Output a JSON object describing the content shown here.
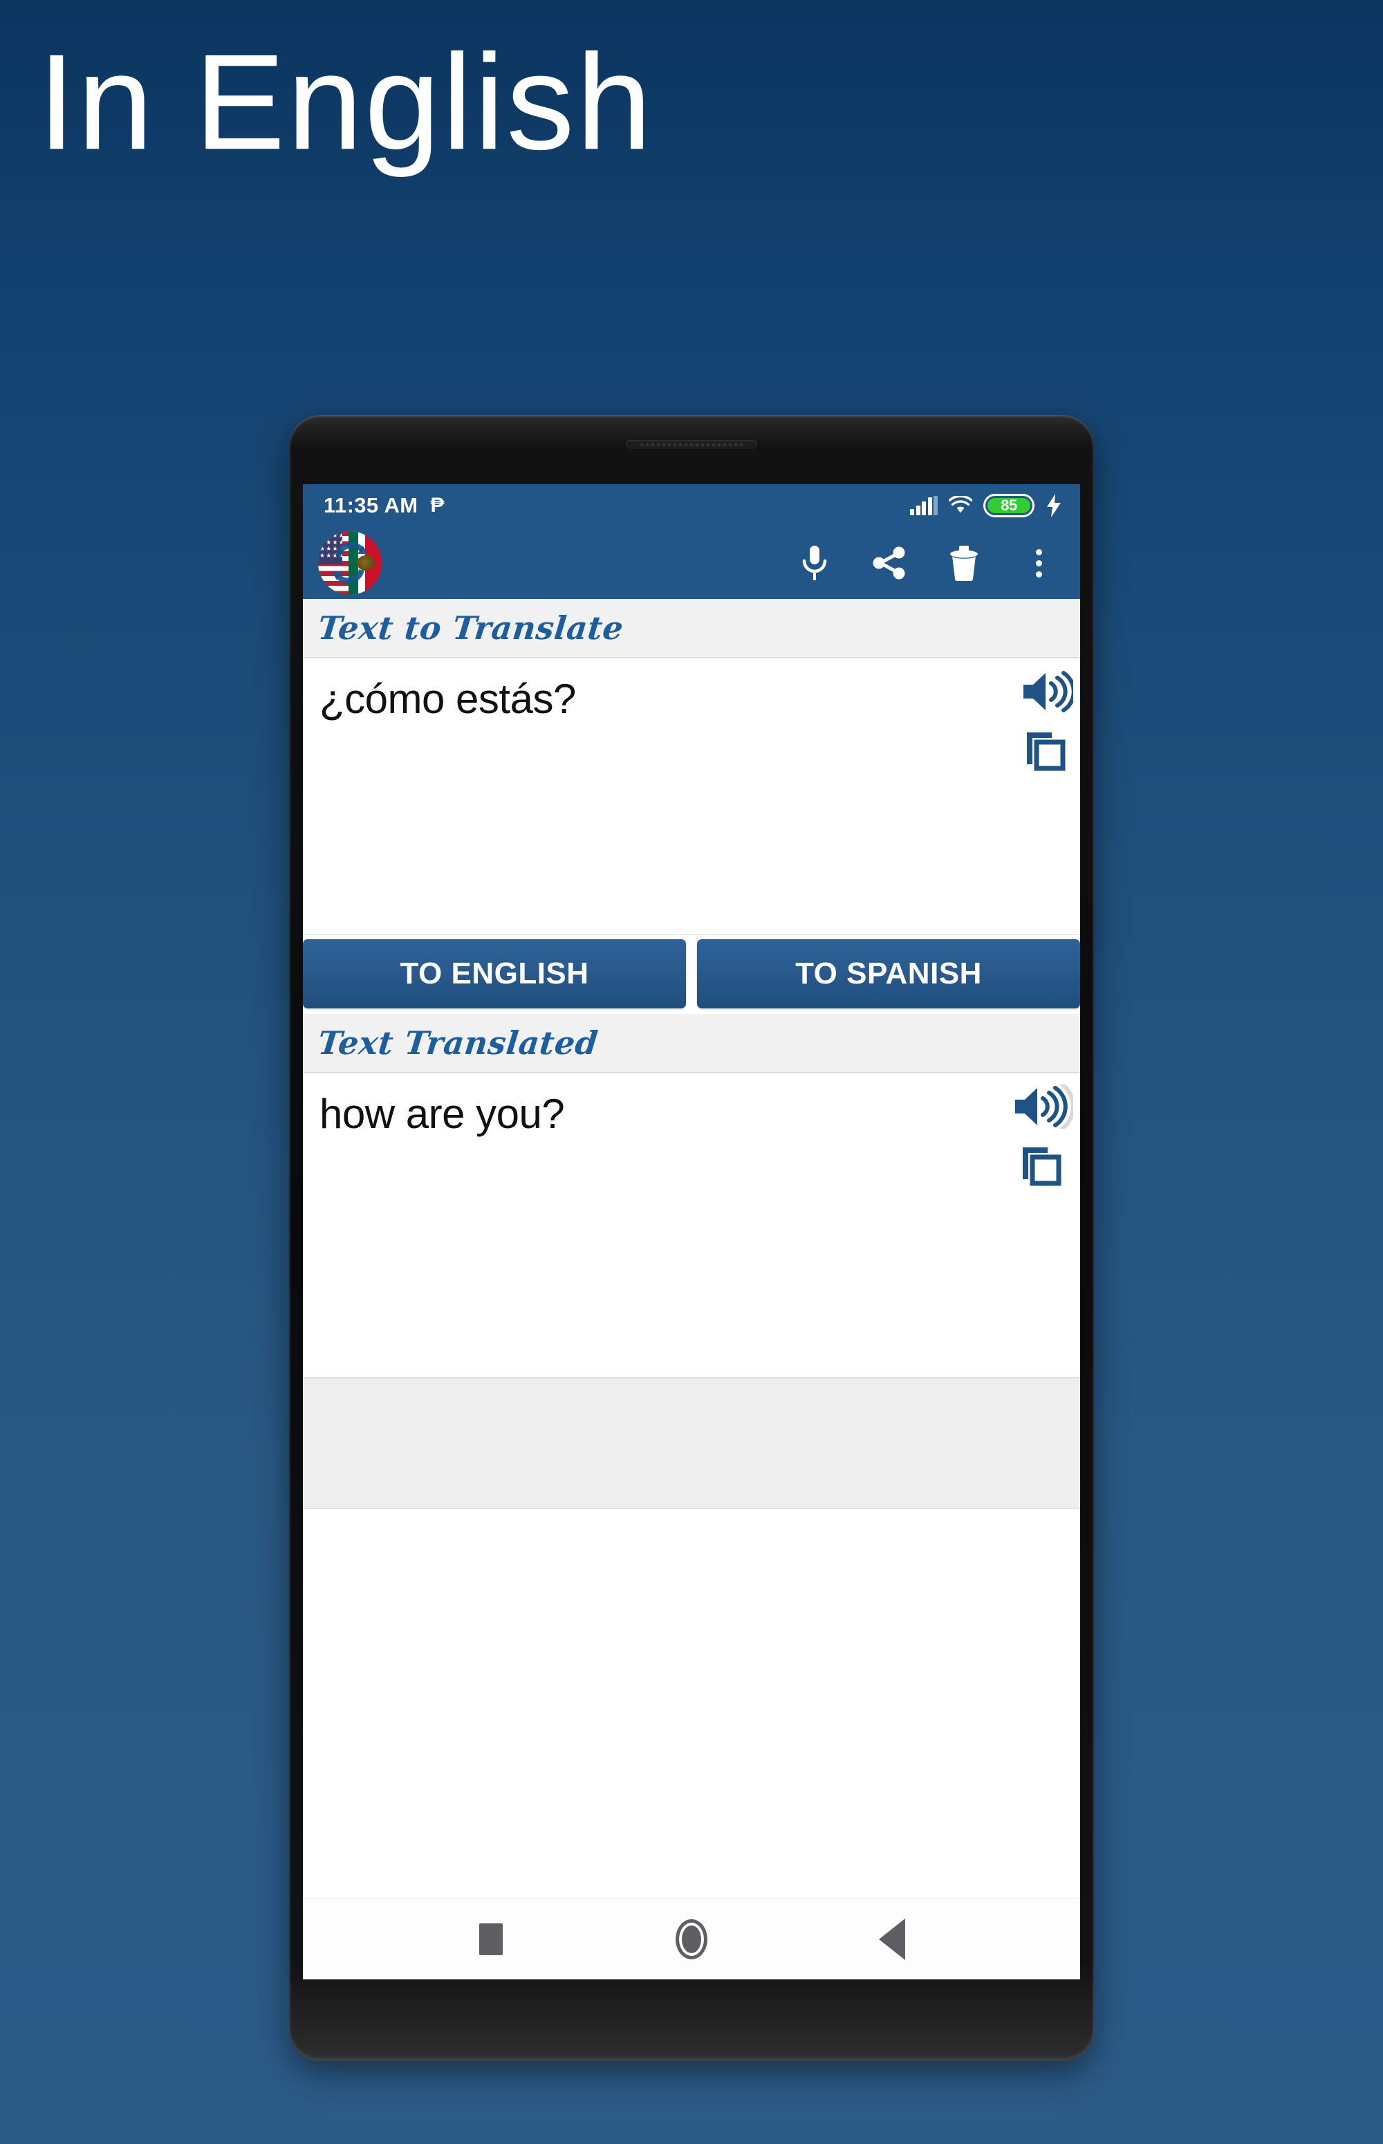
{
  "headline": {
    "text": "In English"
  },
  "status_bar": {
    "time": "11:35 AM",
    "notification_icon": "pin-notification-icon",
    "signal_icon": "cellular-signal-icon",
    "wifi_icon": "wifi-icon",
    "battery_level": "85",
    "charging_icon": "charging-bolt-icon",
    "battery_color": "#33cc33",
    "bar_color": "#225588"
  },
  "app_bar": {
    "logo_icon": "us-mexico-flags-swap-logo",
    "actions": [
      {
        "name": "microphone",
        "icon": "microphone-icon",
        "label": "Voice input"
      },
      {
        "name": "share",
        "icon": "share-icon",
        "label": "Share"
      },
      {
        "name": "delete",
        "icon": "trash-icon",
        "label": "Clear"
      },
      {
        "name": "overflow",
        "icon": "kebab-menu-icon",
        "label": "More options"
      }
    ]
  },
  "input_section": {
    "label": "Text to Translate",
    "value": "¿cómo estás?",
    "placeholder": "Text to Translate",
    "speak_icon": "speaker-icon",
    "copy_icon": "copy-icon"
  },
  "buttons": {
    "to_english": "TO ENGLISH",
    "to_spanish": "TO SPANISH"
  },
  "output_section": {
    "label": "Text Translated",
    "value": "how are you?",
    "speak_icon": "speaker-icon",
    "copy_icon": "copy-icon"
  },
  "nav_bar": {
    "recents": "recents-square-icon",
    "home": "home-circle-icon",
    "back": "back-triangle-icon"
  },
  "colors": {
    "brand_blue": "#225588",
    "accent_blue": "#1f5e9e",
    "button_blue": "#2a5a8d",
    "background_top": "#0c3560",
    "background_bottom": "#2c5b88"
  }
}
